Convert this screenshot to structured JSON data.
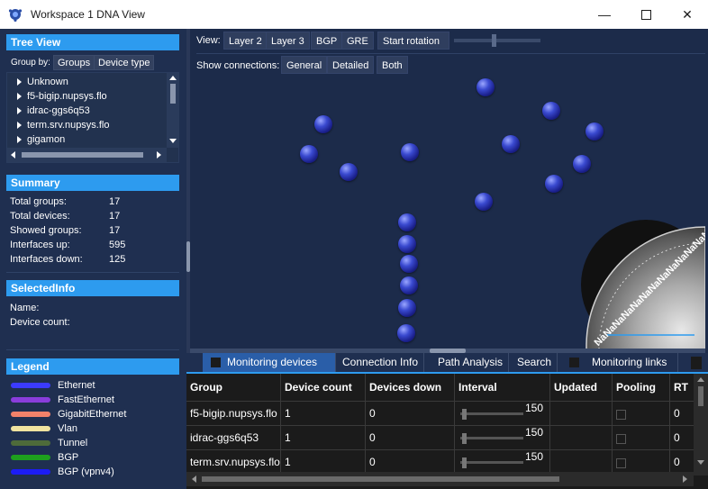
{
  "window": {
    "title": "Workspace 1 DNA View",
    "minimize_icon": "minimize-icon",
    "maximize_icon": "maximize-icon",
    "close_icon": "close-icon"
  },
  "tree_view": {
    "header": "Tree View",
    "group_by_label": "Group by:",
    "group_by_options": [
      "Groups",
      "Device type"
    ],
    "items": [
      "Unknown",
      "f5-bigip.nupsys.flo",
      "idrac-ggs6q53",
      "term.srv.nupsys.flo",
      "gigamon"
    ]
  },
  "summary": {
    "header": "Summary",
    "rows": [
      {
        "label": "Total groups:",
        "value": "17"
      },
      {
        "label": "Total devices:",
        "value": "17"
      },
      {
        "label": "Showed groups:",
        "value": "17"
      },
      {
        "label": "Interfaces up:",
        "value": "595"
      },
      {
        "label": "Interfaces down:",
        "value": "125"
      }
    ]
  },
  "selected_info": {
    "header": "SelectedInfo",
    "name_label": "Name:",
    "device_count_label": "Device count:"
  },
  "legend": {
    "header": "Legend",
    "items": [
      {
        "label": "Ethernet",
        "color": "#3b3bff"
      },
      {
        "label": "FastEthernet",
        "color": "#8a3ddb"
      },
      {
        "label": "GigabitEthernet",
        "color": "#f2826a"
      },
      {
        "label": "Vlan",
        "color": "#f0e3a0"
      },
      {
        "label": "Tunnel",
        "color": "#4e6b3a"
      },
      {
        "label": "BGP",
        "color": "#1ea01e"
      },
      {
        "label": "BGP (vpnv4)",
        "color": "#1c1cf5"
      }
    ]
  },
  "toolbar": {
    "view_label": "View:",
    "view_buttons": [
      "Layer 2",
      "Layer 3",
      "BGP",
      "GRE"
    ],
    "rotation_button": "Start rotation",
    "show_connections_label": "Show connections:",
    "connection_buttons": [
      "General",
      "Detailed",
      "Both"
    ]
  },
  "gauge": {
    "text": "NaNaNaNaNaNaNaNaNaNaNaNaNaNaNa"
  },
  "bottom_tabs": [
    "Monitoring devices",
    "Connection Info",
    "Path Analysis",
    "Search",
    "Monitoring links"
  ],
  "grid": {
    "columns": [
      "Group",
      "Device count",
      "Devices down",
      "Interval",
      "Updated",
      "Pooling",
      "RT"
    ],
    "rows": [
      {
        "group": "f5-bigip.nupsys.flo",
        "device_count": "1",
        "devices_down": "0",
        "interval": "150",
        "updated": "",
        "rt": "0"
      },
      {
        "group": "idrac-ggs6q53",
        "device_count": "1",
        "devices_down": "0",
        "interval": "150",
        "updated": "",
        "rt": "0"
      },
      {
        "group": "term.srv.nupsys.flo",
        "device_count": "1",
        "devices_down": "0",
        "interval": "150",
        "updated": "",
        "rt": "0"
      }
    ]
  },
  "colors": {
    "accent": "#2d9bef",
    "panel": "#1f2f50",
    "sphere": "#2a36c8"
  }
}
